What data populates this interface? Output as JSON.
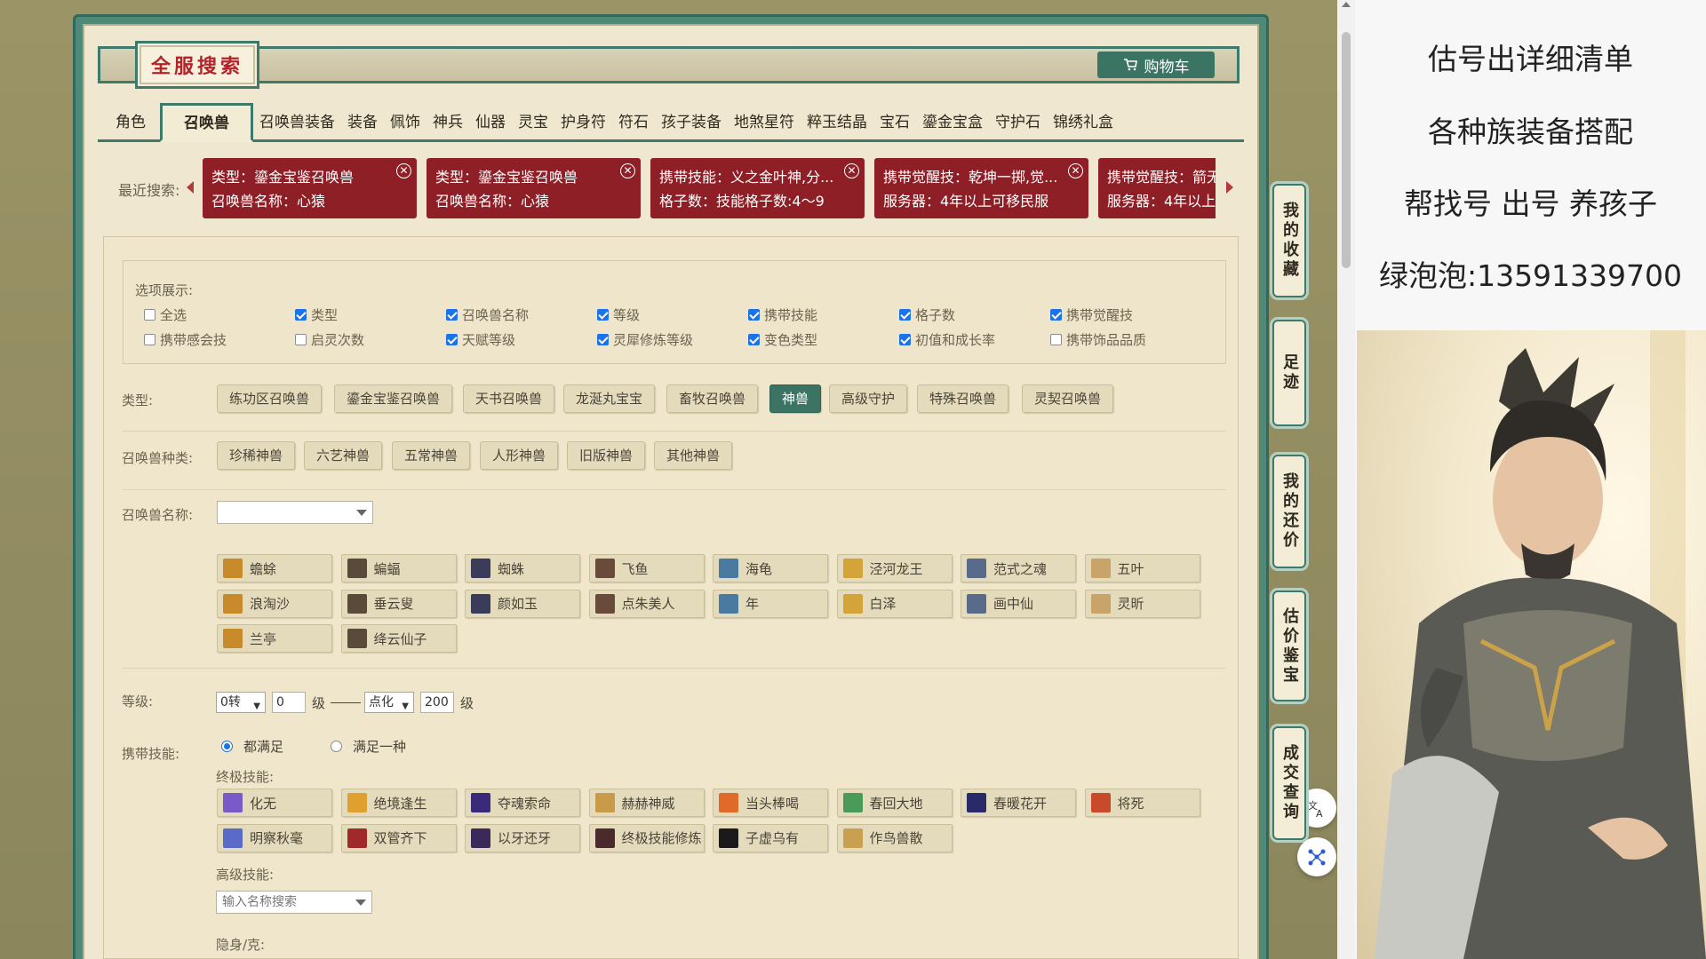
{
  "header": {
    "title": "全服搜索",
    "cart_label": "购物车"
  },
  "tabs": [
    {
      "label": "角色"
    },
    {
      "label": "召唤兽",
      "active": true
    },
    {
      "label": "召唤兽装备"
    },
    {
      "label": "装备"
    },
    {
      "label": "佩饰"
    },
    {
      "label": "神兵"
    },
    {
      "label": "仙器"
    },
    {
      "label": "灵宝"
    },
    {
      "label": "护身符"
    },
    {
      "label": "符石"
    },
    {
      "label": "孩子装备"
    },
    {
      "label": "地煞星符"
    },
    {
      "label": "粹玉结晶"
    },
    {
      "label": "宝石"
    },
    {
      "label": "鎏金宝盒"
    },
    {
      "label": "守护石"
    },
    {
      "label": "锦绣礼盒"
    }
  ],
  "recent": {
    "label": "最近搜索:",
    "cards": [
      {
        "line1": "类型：鎏金宝鉴召唤兽",
        "line2": "召唤兽名称：心猿"
      },
      {
        "line1": "类型：鎏金宝鉴召唤兽",
        "line2": "召唤兽名称：心猿"
      },
      {
        "line1": "携带技能：义之金叶神,分...",
        "line2": "格子数：技能格子数:4～9"
      },
      {
        "line1": "携带觉醒技：乾坤一掷,觉...",
        "line2": "服务器：4年以上可移民服"
      },
      {
        "line1": "携带觉醒技：箭无",
        "line2": "服务器：4年以上"
      }
    ]
  },
  "options": {
    "title": "选项展示:",
    "items": [
      {
        "label": "全选",
        "checked": false
      },
      {
        "label": "类型",
        "checked": true
      },
      {
        "label": "召唤兽名称",
        "checked": true
      },
      {
        "label": "等级",
        "checked": true
      },
      {
        "label": "携带技能",
        "checked": true
      },
      {
        "label": "格子数",
        "checked": true
      },
      {
        "label": "携带觉醒技",
        "checked": true
      },
      {
        "label": "携带感会技",
        "checked": false
      },
      {
        "label": "启灵次数",
        "checked": false
      },
      {
        "label": "天赋等级",
        "checked": true
      },
      {
        "label": "灵犀修炼等级",
        "checked": true
      },
      {
        "label": "变色类型",
        "checked": true
      },
      {
        "label": "初值和成长率",
        "checked": true
      },
      {
        "label": "携带饰品品质",
        "checked": false
      }
    ]
  },
  "type_filter": {
    "label": "类型:",
    "options": [
      "练功区召唤兽",
      "鎏金宝鉴召唤兽",
      "天书召唤兽",
      "龙涎丸宝宝",
      "畜牧召唤兽",
      "神兽",
      "高级守护",
      "特殊召唤兽",
      "灵契召唤兽"
    ],
    "selected": "神兽"
  },
  "species_filter": {
    "label": "召唤兽种类:",
    "options": [
      "珍稀神兽",
      "六艺神兽",
      "五常神兽",
      "人形神兽",
      "旧版神兽",
      "其他神兽"
    ]
  },
  "name_filter": {
    "label": "召唤兽名称:",
    "value": "",
    "pets": [
      "蟾蜍",
      "蝙蝠",
      "蜘蛛",
      "飞鱼",
      "海龟",
      "泾河龙王",
      "范式之魂",
      "五叶",
      "浪淘沙",
      "垂云叟",
      "颜如玉",
      "点朱美人",
      "年",
      "白泽",
      "画中仙",
      "灵昕",
      "兰亭",
      "绛云仙子"
    ]
  },
  "level_filter": {
    "label": "等级:",
    "from_select": "0转",
    "from_value": "0",
    "unit": "级",
    "to_select": "点化",
    "to_value": "200"
  },
  "skills_filter": {
    "label": "携带技能:",
    "radio_all": "都满足",
    "radio_any": "满足一种",
    "ultimate_label": "终极技能:",
    "ultimate": [
      "化无",
      "绝境逢生",
      "夺魂索命",
      "赫赫神威",
      "当头棒喝",
      "春回大地",
      "春暖花开",
      "将死",
      "明察秋毫",
      "双管齐下",
      "以牙还牙",
      "终极技能修炼",
      "子虚乌有",
      "作鸟兽散"
    ],
    "advanced_label": "高级技能:",
    "advanced_placeholder": "输入名称搜索",
    "stealth_label": "隐身/克:"
  },
  "side_nav": [
    "我的收藏",
    "足迹",
    "我的还价",
    "估价鉴宝",
    "成交查询"
  ],
  "ad": {
    "lines": [
      "估号出详细清单",
      "各种族装备搭配",
      "帮找号 出号 养孩子",
      "绿泡泡:13591339700"
    ]
  },
  "colors": {
    "accent": "#3c7464",
    "recent_card": "#8e1f26",
    "title_red": "#b4232a"
  },
  "icons": {
    "cart": "cart-icon",
    "translate": "translate-icon",
    "network": "network-icon"
  }
}
